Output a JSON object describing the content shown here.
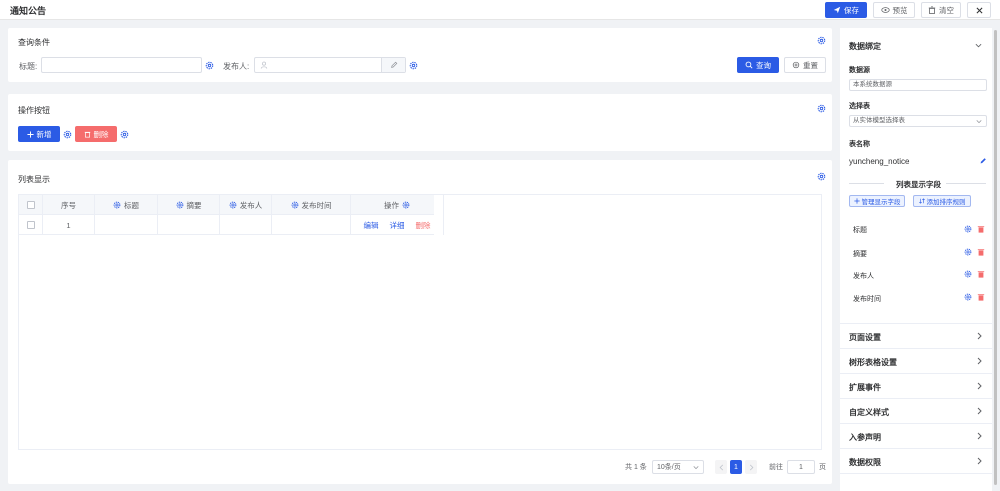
{
  "header": {
    "title": "通知公告",
    "save_label": "保存",
    "preview_label": "预览",
    "clear_label": "清空"
  },
  "query": {
    "section_title": "查询条件",
    "title_label": "标题:",
    "publisher_label": "发布人:",
    "search_label": "查询",
    "reset_label": "重置"
  },
  "actions": {
    "section_title": "操作按钮",
    "add_label": "新增",
    "delete_label": "删除"
  },
  "list": {
    "section_title": "列表显示",
    "columns": [
      "序号",
      "标题",
      "摘要",
      "发布人",
      "发布时间",
      "操作"
    ],
    "row": {
      "index": "1",
      "edit": "编辑",
      "detail": "详细",
      "delete": "删除"
    },
    "pager": {
      "total": "共 1 条",
      "page_size": "10条/页",
      "current": "1",
      "goto": "前往",
      "goto_value": "1",
      "page_suffix": "页"
    }
  },
  "sidebar": {
    "data_binding": "数据绑定",
    "datasource_label": "数据源",
    "datasource_value": "本系统数据源",
    "select_table_label": "选择表",
    "select_table_value": "从实体模型选择表",
    "table_name_label": "表名称",
    "table_name_value": "yuncheng_notice",
    "list_fields_title": "列表显示字段",
    "manage_fields_label": "管理显示字段",
    "add_sort_label": "添加排序规则",
    "fields": [
      "标题",
      "摘要",
      "发布人",
      "发布时间"
    ],
    "sections": [
      "页面设置",
      "树形表格设置",
      "扩展事件",
      "自定义样式",
      "入参声明",
      "数据权限"
    ]
  },
  "colors": {
    "primary": "#2b5be5",
    "danger": "#f56c6c"
  },
  "icons": [
    "send-icon",
    "eye-icon",
    "trash-icon",
    "close-icon",
    "gear-icon",
    "user-icon",
    "edit-icon",
    "search-icon",
    "refresh-icon",
    "plus-icon",
    "sort-icon",
    "chevron-down-icon",
    "chevron-right-icon",
    "chevron-left-icon"
  ]
}
